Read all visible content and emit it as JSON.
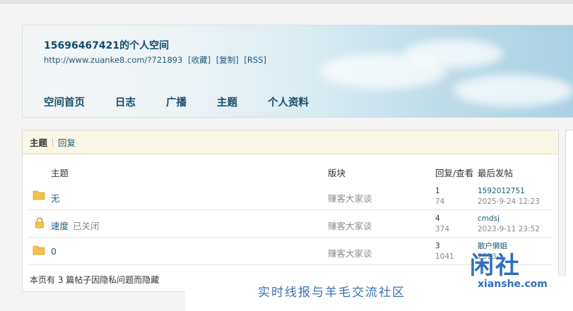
{
  "header": {
    "title": "15696467421的个人空间",
    "url": "http://www.zuanke8.com/?721893",
    "actions": [
      "[收藏]",
      "[复制]",
      "[RSS]"
    ]
  },
  "nav": [
    "空间首页",
    "日志",
    "广播",
    "主题",
    "个人资料"
  ],
  "tabs": {
    "active": "主题",
    "other": "回复"
  },
  "table": {
    "headers": {
      "subject": "主题",
      "forum": "版块",
      "replies_views": "回复/查看",
      "last_post": "最后发帖"
    },
    "rows": [
      {
        "subject": "无",
        "status": "",
        "forum": "赚客大家谈",
        "replies": "1",
        "views": "74",
        "last_user": "1592012751",
        "last_time": "2025-9-24 12:23",
        "icon": "folder-icon"
      },
      {
        "subject": "速度",
        "status": "已关闭",
        "forum": "赚客大家谈",
        "replies": "4",
        "views": "374",
        "last_user": "cmdsj",
        "last_time": "2023-9-11 23:52",
        "icon": "lock-icon"
      },
      {
        "subject": "0",
        "status": "",
        "forum": "赚客大家谈",
        "replies": "3",
        "views": "1041",
        "last_user": "散户懒姐",
        "last_time": "2023-",
        "icon": "folder-icon"
      }
    ],
    "hidden_note": "本页有 3 篇帖子因隐私问题而隐藏"
  },
  "watermark": {
    "logo": "闲社",
    "url": "xianshe.com",
    "slogan": "实时线报与羊毛交流社区"
  },
  "colors": {
    "link": "#1e5a7b",
    "tab_bg": "#fbf7e6",
    "watermark": "#2f6fc0"
  }
}
